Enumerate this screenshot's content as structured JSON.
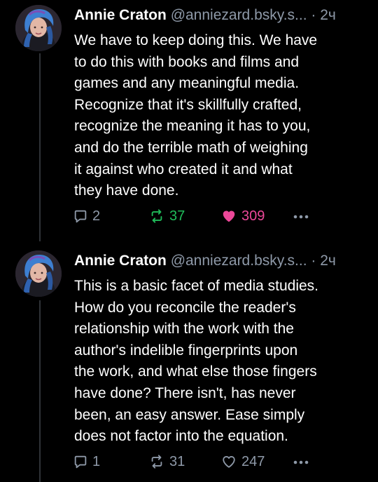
{
  "colors": {
    "background": "#000000",
    "text": "#ffffff",
    "muted": "#8e99a8",
    "repost_active": "#20bc5a",
    "like_active": "#ec4899",
    "thread_line": "#2f3337"
  },
  "posts": [
    {
      "author": {
        "name": "Annie Craton",
        "handle": "@anniezard.bsky.s...",
        "avatar_icon": "avatar-blue-haired-woman"
      },
      "separator": "·",
      "time": "2ч",
      "text": "We have to keep doing this. We have\nto do this with books and films and\ngames and any meaningful media.\nRecognize that it's skillfully crafted,\nrecognize the meaning it has to you,\nand do the terrible math of weighing\nit against who created it and what\nthey have done.",
      "stats": {
        "replies": "2",
        "reposts": "37",
        "likes": "309",
        "reposted": true,
        "liked": true
      }
    },
    {
      "author": {
        "name": "Annie Craton",
        "handle": "@anniezard.bsky.s...",
        "avatar_icon": "avatar-blue-haired-woman"
      },
      "separator": "·",
      "time": "2ч",
      "text": "This is a basic facet of media studies.\nHow do you reconcile the reader's\nrelationship with the work with the\nauthor's indelible fingerprints upon\nthe work, and what else those fingers\nhave done? There isn't, has never\nbeen, an easy answer. Ease simply\ndoes not factor into the equation.",
      "stats": {
        "replies": "1",
        "reposts": "31",
        "likes": "247",
        "reposted": false,
        "liked": false
      }
    }
  ]
}
